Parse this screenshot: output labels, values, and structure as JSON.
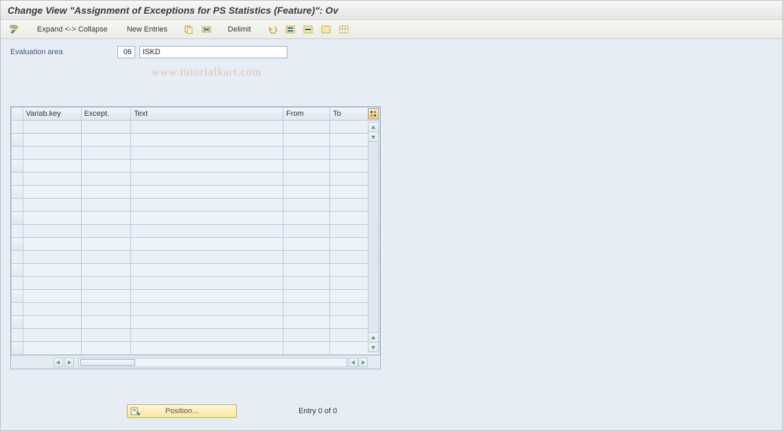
{
  "pageTitle": "Change View \"Assignment of Exceptions for PS Statistics (Feature)\": Ov",
  "toolbar": {
    "expandCollapse": "Expand <-> Collapse",
    "newEntries": "New Entries",
    "delimit": "Delimit"
  },
  "form": {
    "evalAreaLabel": "Evaluation area",
    "evalAreaCode": "06",
    "evalAreaDesc": "ISKD"
  },
  "table": {
    "columns": {
      "variabKey": "Variab.key",
      "except": "Except.",
      "text": "Text",
      "from": "From",
      "to": "To",
      "config": ""
    },
    "rowCount": 18
  },
  "footer": {
    "positionBtn": "Position...",
    "entryStatus": "Entry 0 of 0"
  },
  "watermark": "www.tutorialkart.com"
}
